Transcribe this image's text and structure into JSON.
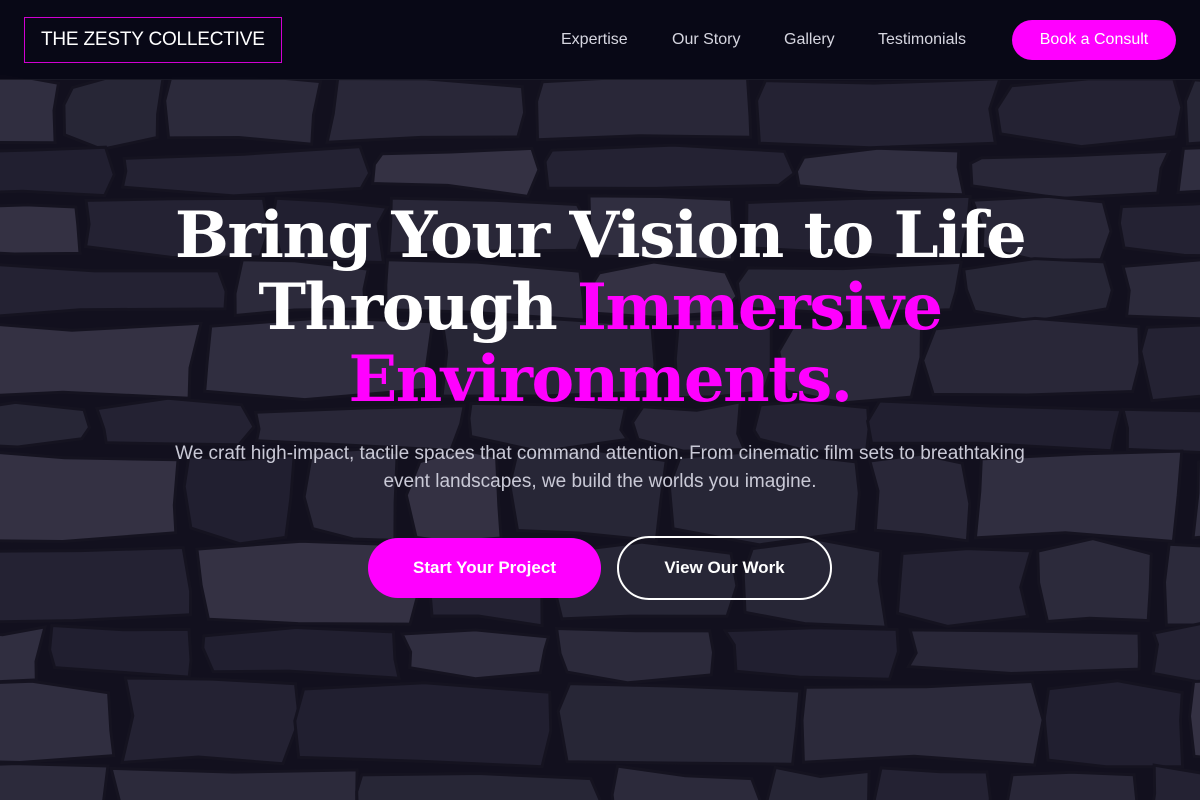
{
  "header": {
    "logo_text": "THE ZESTY COLLECTIVE",
    "nav": [
      {
        "label": "Expertise"
      },
      {
        "label": "Our Story"
      },
      {
        "label": "Gallery"
      },
      {
        "label": "Testimonials"
      }
    ],
    "cta_label": "Book a Consult"
  },
  "hero": {
    "title_line1": "Bring Your Vision to Life",
    "title_line2_plain": "Through ",
    "title_line2_accent": "Immersive",
    "title_line3_accent": "Environments.",
    "subtitle": "We craft high-impact, tactile spaces that command attention. From cinematic film sets to breathtaking event landscapes, we build the worlds you imagine.",
    "primary_button": "Start Your Project",
    "secondary_button": "View Our Work"
  },
  "theme": {
    "accent": "#ff00ff",
    "header_bg": "#080816",
    "stone_dark": "#1f1e2a",
    "stone_light": "#3d3b49"
  },
  "background": {
    "image": "dark stacked stone wall texture"
  }
}
